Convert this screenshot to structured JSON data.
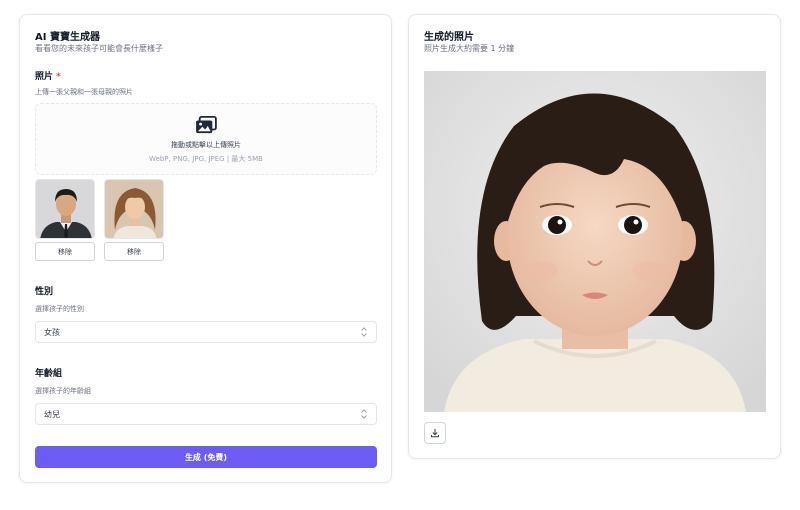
{
  "generator": {
    "title": "AI 寶寶生成器",
    "subtitle": "看看您的未來孩子可能會長什麼樣子"
  },
  "photos": {
    "label": "照片",
    "required_mark": "*",
    "help": "上傳一張父親和一張母親的照片",
    "dropzone_title": "拖動或點擊以上傳照片",
    "dropzone_hint": "WebP, PNG, JPG, JPEG | 最大 5MB",
    "remove_labels": [
      "移除",
      "移除"
    ],
    "uploads": [
      "father-photo",
      "mother-photo"
    ]
  },
  "gender": {
    "label": "性別",
    "help": "選擇孩子的性別",
    "selected": "女孩"
  },
  "age": {
    "label": "年齡組",
    "help": "選擇孩子的年齡組",
    "selected": "幼兒"
  },
  "generate_label": "生成 (免費)",
  "result": {
    "title": "生成的照片",
    "subtitle": "照片生成大約需要 1 分鐘"
  },
  "colors": {
    "primary": "#6b5cf6",
    "required": "#ef4444",
    "border": "#e5e7eb"
  },
  "icons": [
    "image-upload-icon",
    "chevron-updown-icon",
    "download-icon"
  ]
}
